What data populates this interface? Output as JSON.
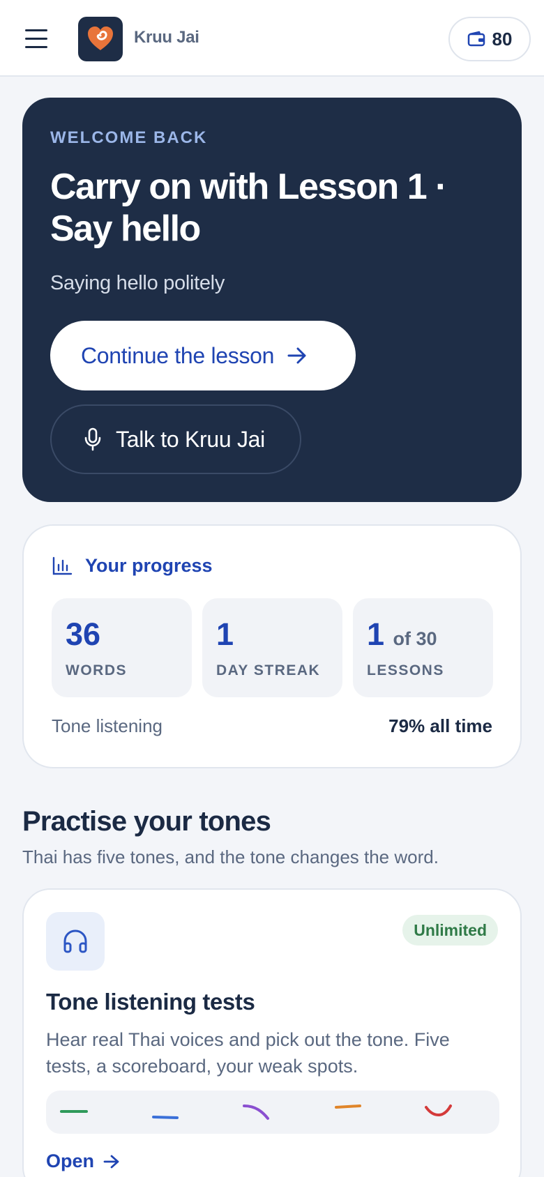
{
  "header": {
    "app_name": "Kruu Jai",
    "coins": "80",
    "icons": {
      "menu": "hamburger-icon",
      "logo": "heart-logo",
      "wallet": "wallet-icon"
    }
  },
  "hero": {
    "eyebrow": "WELCOME BACK",
    "title": "Carry on with Lesson 1 · Say hello",
    "subtitle": "Saying hello politely",
    "continue_label": "Continue the lesson",
    "talk_label": "Talk to Kruu Jai"
  },
  "progress": {
    "title": "Your progress",
    "stats": [
      {
        "value": "36",
        "label": "WORDS"
      },
      {
        "value": "1",
        "label": "DAY STREAK"
      },
      {
        "value": "1",
        "suffix": "of 30",
        "label": "LESSONS"
      }
    ],
    "tone_label": "Tone listening",
    "tone_value": "79% all time"
  },
  "practise": {
    "title": "Practise your tones",
    "subtitle": "Thai has five tones, and the tone changes the word.",
    "card": {
      "badge": "Unlimited",
      "title": "Tone listening tests",
      "description": "Hear real Thai voices and pick out the tone. Five tests, a scoreboard, your weak spots.",
      "open_label": "Open",
      "tone_colors": [
        "#2f9a5a",
        "#3a6fd8",
        "#8a4fd0",
        "#e0852a",
        "#d43a3a"
      ]
    }
  },
  "colors": {
    "navy": "#1e2d46",
    "accent_blue": "#1f44b2",
    "background": "#f3f5f9",
    "success": "#2f7a47"
  }
}
